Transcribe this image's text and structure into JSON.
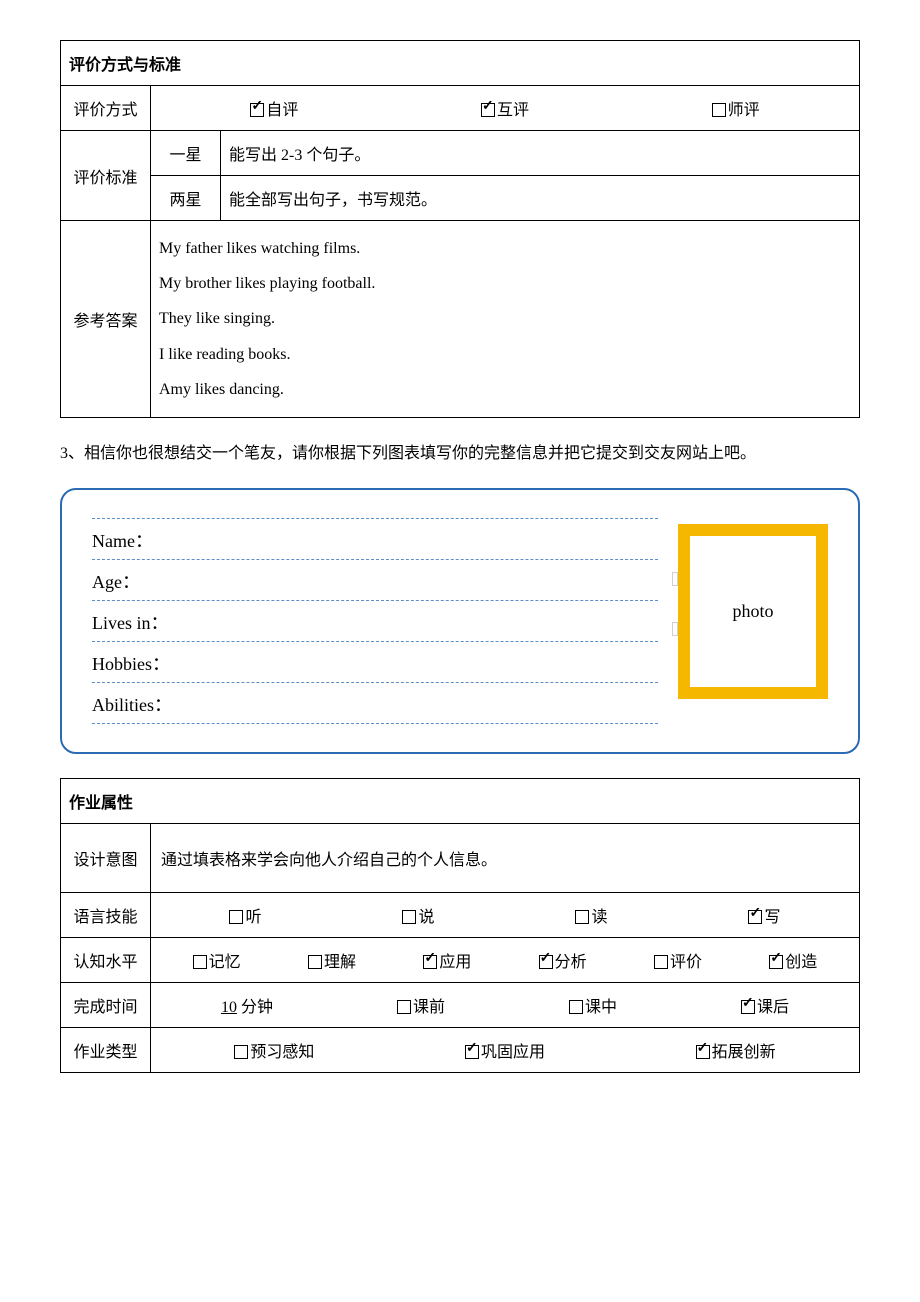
{
  "table1": {
    "header": "评价方式与标准",
    "row_eval_mode_label": "评价方式",
    "eval_modes": [
      {
        "label": "自评",
        "checked": true
      },
      {
        "label": "互评",
        "checked": true
      },
      {
        "label": "师评",
        "checked": false
      }
    ],
    "row_criteria_label": "评价标准",
    "criteria": [
      {
        "stars": "一星",
        "desc": "能写出 2-3 个句子。"
      },
      {
        "stars": "两星",
        "desc": "能全部写出句子，书写规范。"
      }
    ],
    "row_answer_label": "参考答案",
    "answers": [
      "My father likes watching films.",
      "My brother likes playing football.",
      "They like singing.",
      "I like reading books.",
      "Amy likes dancing."
    ]
  },
  "q3_text": "3、相信你也很想结交一个笔友，请你根据下列图表填写你的完整信息并把它提交到交友网站上吧。",
  "form": {
    "fields": [
      "Name：",
      "Age：",
      "Lives in：",
      "Hobbies：",
      "Abilities："
    ],
    "photo_label": "photo"
  },
  "table2": {
    "header": "作业属性",
    "intent_label": "设计意图",
    "intent_text": "通过填表格来学会向他人介绍自己的个人信息。",
    "skill_label": "语言技能",
    "skills": [
      {
        "label": "听",
        "checked": false
      },
      {
        "label": "说",
        "checked": false
      },
      {
        "label": "读",
        "checked": false
      },
      {
        "label": "写",
        "checked": true
      }
    ],
    "cog_label": "认知水平",
    "cogs": [
      {
        "label": "记忆",
        "checked": false
      },
      {
        "label": "理解",
        "checked": false
      },
      {
        "label": "应用",
        "checked": true
      },
      {
        "label": "分析",
        "checked": true
      },
      {
        "label": "评价",
        "checked": false
      },
      {
        "label": "创造",
        "checked": true
      }
    ],
    "time_label": "完成时间",
    "time_value": "10",
    "time_unit": "分钟",
    "time_opts": [
      {
        "label": "课前",
        "checked": false
      },
      {
        "label": "课中",
        "checked": false
      },
      {
        "label": "课后",
        "checked": true
      }
    ],
    "type_label": "作业类型",
    "types": [
      {
        "label": "预习感知",
        "checked": false
      },
      {
        "label": "巩固应用",
        "checked": true
      },
      {
        "label": "拓展创新",
        "checked": true
      }
    ]
  }
}
